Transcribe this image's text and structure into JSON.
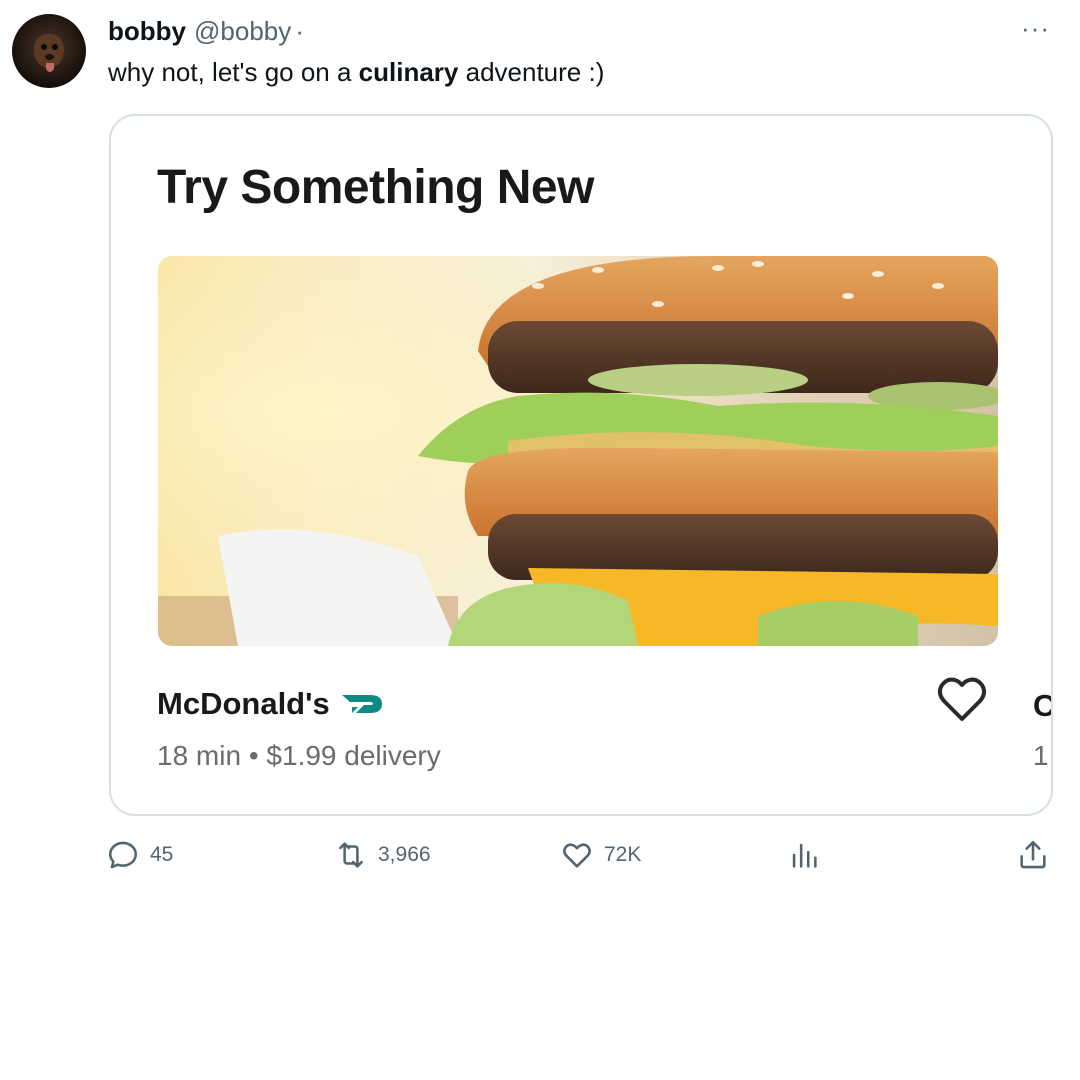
{
  "tweet": {
    "author": {
      "name": "bobby",
      "handle": "@bobby",
      "separator": "·"
    },
    "more_label": "···",
    "text_before": "why not, let's go on a ",
    "text_bold": "culinary",
    "text_after": " adventure :)"
  },
  "card": {
    "title": "Try Something New",
    "restaurant_name": "McDonald's",
    "delivery_time": "18 min",
    "meta_separator": "•",
    "delivery_fee": "$1.99 delivery",
    "next_card_title_fragment": "C",
    "next_card_meta_fragment": "1:",
    "dashpass_color": "#0e8a84"
  },
  "actions": {
    "replies": "45",
    "retweets": "3,966",
    "likes": "72K"
  },
  "colors": {
    "text": "#0f1419",
    "secondary": "#536471",
    "card_border": "#d7dfe4"
  }
}
